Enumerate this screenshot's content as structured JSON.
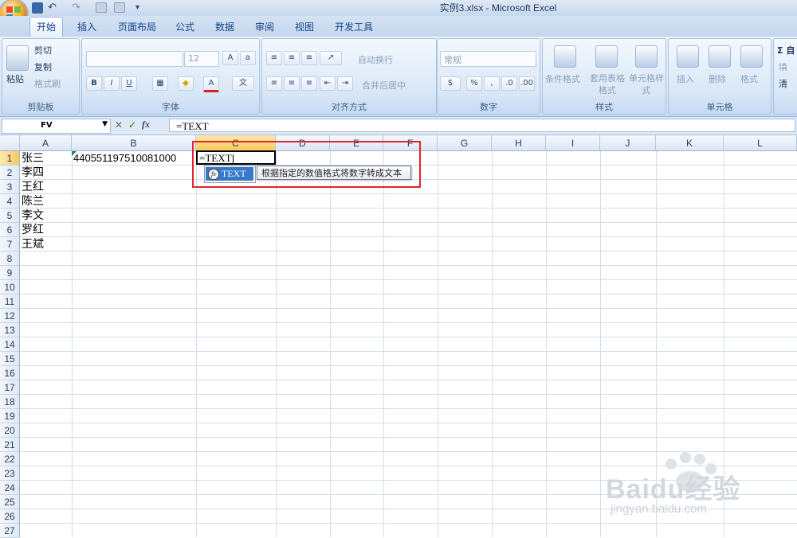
{
  "window": {
    "title": "实例3.xlsx - Microsoft Excel"
  },
  "tabs": [
    "开始",
    "插入",
    "页面布局",
    "公式",
    "数据",
    "审阅",
    "视图",
    "开发工具"
  ],
  "ribbon": {
    "clipboard": {
      "label": "剪贴板",
      "paste": "粘贴",
      "cut": "剪切",
      "copy": "复制",
      "format_painter": "格式刷"
    },
    "font": {
      "label": "字体",
      "size": "12",
      "bold": "B",
      "italic": "I",
      "underline": "U",
      "grow": "A",
      "color_a": "A"
    },
    "alignment": {
      "label": "对齐方式",
      "wrap": "自动换行",
      "merge": "合并后居中"
    },
    "number": {
      "label": "数字",
      "format": "常规",
      "percent": "%",
      "comma": ","
    },
    "styles": {
      "label": "样式",
      "conditional": "条件格式",
      "table": "套用表格格式",
      "cell": "单元格样式"
    },
    "cells": {
      "label": "单元格",
      "insert": "插入",
      "delete": "删除",
      "format": "格式"
    },
    "editing": {
      "sum": "Σ 自",
      "fill": "填",
      "clear": "清"
    }
  },
  "formula_bar": {
    "name_box": "FV",
    "fx": "fx",
    "value": "=TEXT"
  },
  "columns": [
    "A",
    "B",
    "C",
    "D",
    "E",
    "F",
    "G",
    "H",
    "I",
    "J",
    "K",
    "L"
  ],
  "selected_column": "C",
  "rows": [
    "1",
    "2",
    "3",
    "4",
    "5",
    "6",
    "7",
    "8",
    "9",
    "10",
    "11",
    "12",
    "13",
    "14",
    "15",
    "16",
    "17",
    "18",
    "19",
    "20",
    "21",
    "22",
    "23",
    "24",
    "25",
    "26",
    "27"
  ],
  "selected_row": "1",
  "cells": {
    "A1": "张三",
    "A2": "李四",
    "A3": "王红",
    "A4": "陈兰",
    "A5": "李文",
    "A6": "罗红",
    "A7": "王斌",
    "B1": "440551197510081000",
    "C1": "=TEXT"
  },
  "autocomplete": {
    "item": "TEXT",
    "tooltip": "根据指定的数值格式将数字转成文本"
  },
  "watermark": {
    "brand": "Baidu经验",
    "url": "jingyan.baidu.com"
  },
  "colors": {
    "highlight_box": "#e0262a",
    "selected_header": "#f9c95d",
    "autocomplete_selection": "#3679c9"
  }
}
